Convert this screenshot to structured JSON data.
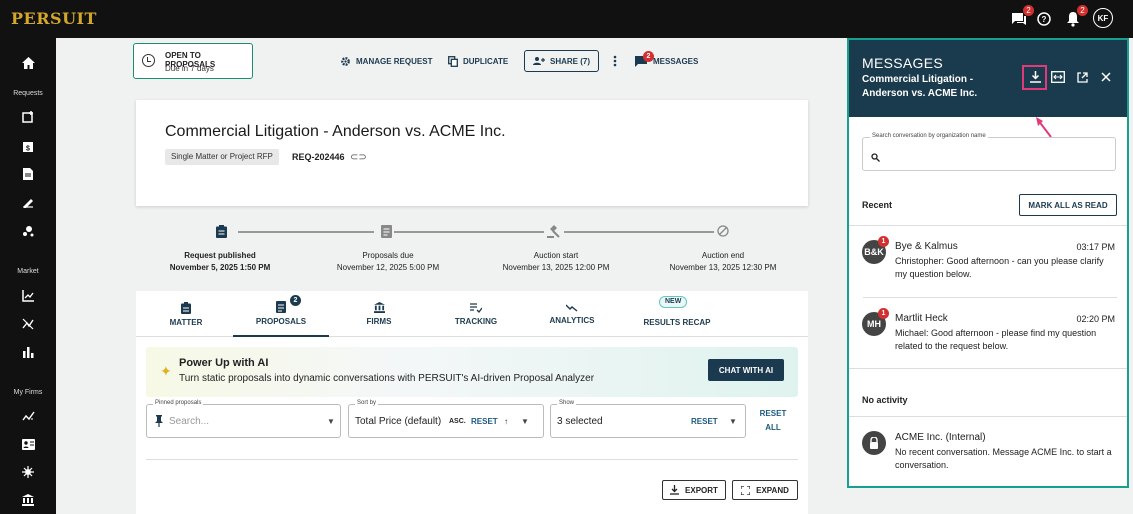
{
  "app": {
    "logo": "PERSUIT"
  },
  "topbar": {
    "messages_badge": "2",
    "notifications_badge": "2",
    "avatar_initials": "KF"
  },
  "sidebar": {
    "sections": [
      "Requests",
      "Market",
      "My Firms"
    ]
  },
  "status": {
    "title": "OPEN TO PROPOSALS",
    "subtitle": "Due in 7 days"
  },
  "toolbar": {
    "manage": "MANAGE REQUEST",
    "duplicate": "DUPLICATE",
    "share": "SHARE (7)",
    "messages": "MESSAGES",
    "messages_badge": "2"
  },
  "request": {
    "title": "Commercial Litigation - Anderson vs. ACME Inc.",
    "type_chip": "Single Matter or Project RFP",
    "id": "REQ-202446"
  },
  "timeline": [
    {
      "label": "Request published",
      "date": "November 5, 2025 1:50 PM"
    },
    {
      "label": "Proposals due",
      "date": "November 12, 2025 5:00 PM"
    },
    {
      "label": "Auction start",
      "date": "November 13, 2025 12:00 PM"
    },
    {
      "label": "Auction end",
      "date": "November 13, 2025 12:30 PM"
    }
  ],
  "tabs": {
    "matter": "MATTER",
    "proposals": "PROPOSALS",
    "proposals_badge": "2",
    "firms": "FIRMS",
    "tracking": "TRACKING",
    "analytics": "ANALYTICS",
    "results": "RESULTS RECAP",
    "new_badge": "NEW"
  },
  "ai": {
    "title": "Power Up with AI",
    "subtitle": "Turn static proposals into dynamic conversations with PERSUIT's AI-driven Proposal Analyzer",
    "button": "CHAT WITH AI"
  },
  "filters": {
    "pinned_label": "Pinned proposals",
    "pinned_placeholder": "Search...",
    "sort_label": "Sort by",
    "sort_value": "Total Price (default)",
    "sort_dir": "ASC.",
    "sort_reset": "RESET",
    "show_label": "Show",
    "show_value": "3 selected",
    "show_reset": "RESET",
    "reset_all_1": "RESET",
    "reset_all_2": "ALL"
  },
  "actions": {
    "export": "EXPORT",
    "expand": "EXPAND"
  },
  "messages": {
    "title": "MESSAGES",
    "subtitle": "Commercial Litigation - Anderson vs. ACME Inc.",
    "search_label": "Search conversation by organization name",
    "recent_label": "Recent",
    "mark_all": "MARK ALL AS READ",
    "conversations": [
      {
        "initials": "B&K",
        "badge": "1",
        "name": "Bye & Kalmus",
        "time": "03:17 PM",
        "text": "Christopher: Good afternoon - can you please clarify my question below."
      },
      {
        "initials": "MH",
        "badge": "1",
        "name": "Martlit Heck",
        "time": "02:20 PM",
        "text": "Michael: Good afternoon - please find my question related to the request below."
      }
    ],
    "no_activity_label": "No activity",
    "internal": {
      "name": "ACME Inc. (Internal)",
      "text": "No recent conversation. Message ACME Inc. to start a conversation."
    }
  },
  "colors": {
    "accent": "#1c3a4f",
    "teal": "#17a08e",
    "highlight": "#e03a7a",
    "badge": "#d32f2f"
  }
}
